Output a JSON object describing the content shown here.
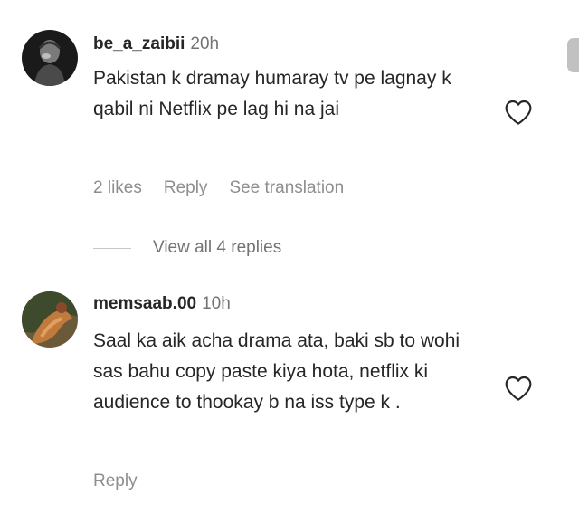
{
  "comments": [
    {
      "username": "be_a_zaibii",
      "time": "20h",
      "text": "Pakistan k dramay humaray tv pe lagnay k qabil ni Netflix pe lag hi na jai",
      "likes": "2 likes",
      "reply": "Reply",
      "translate": "See translation",
      "view_replies": "View all 4 replies"
    },
    {
      "username": "memsaab.00",
      "time": "10h",
      "text": "Saal ka aik acha drama ata, baki sb to wohi sas bahu copy paste kiya hota, netflix ki audience to thookay b na iss type k .",
      "reply": "Reply"
    }
  ],
  "icons": {
    "like": "heart-outline-icon"
  },
  "colors": {
    "text": "#262626",
    "secondary": "#737373",
    "action": "#8e8e8e"
  }
}
